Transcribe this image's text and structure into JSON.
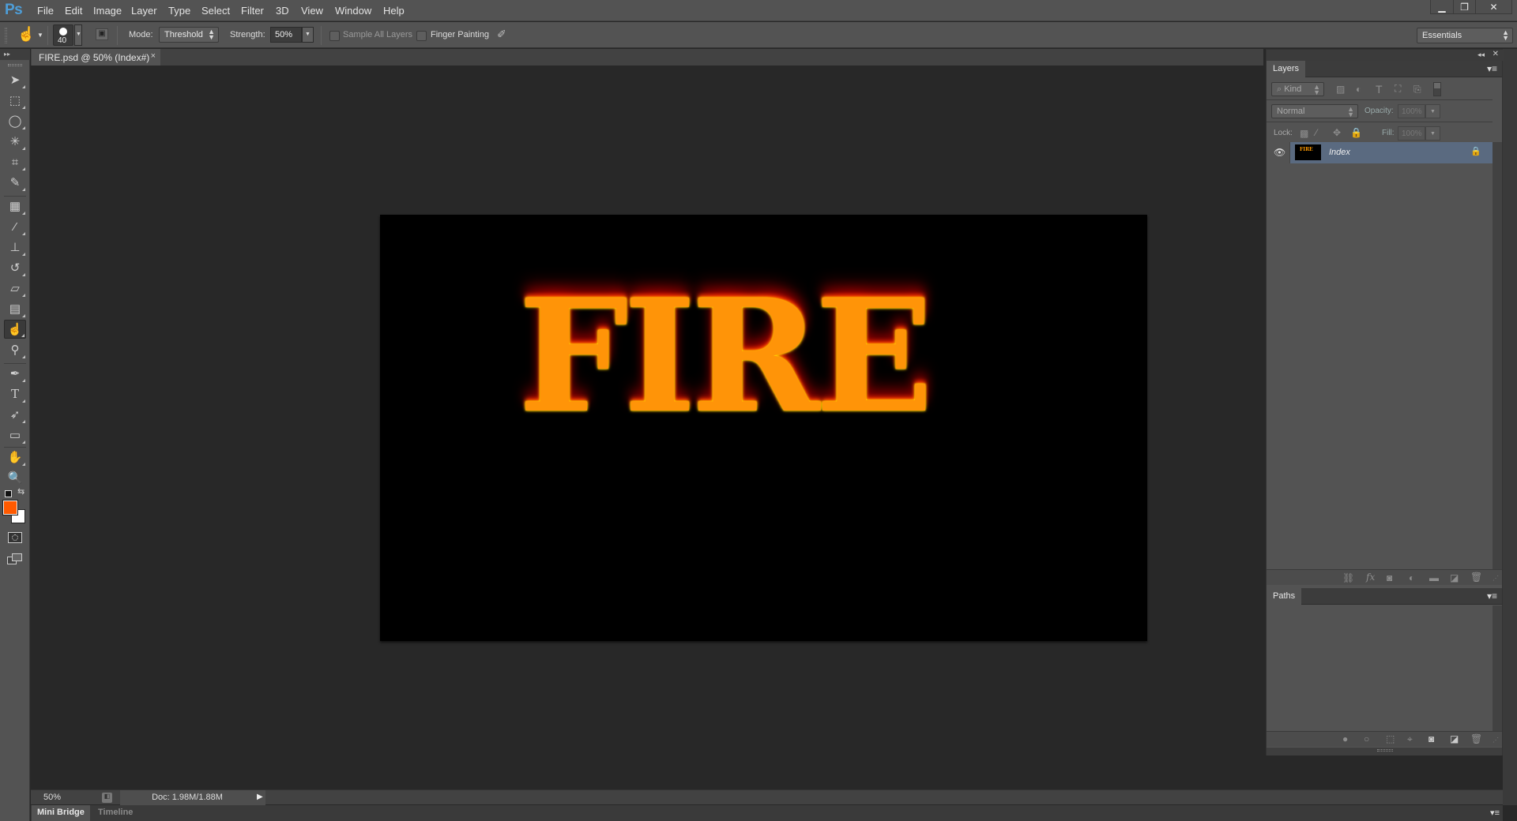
{
  "app": {
    "logo": "Ps"
  },
  "menu": [
    "File",
    "Edit",
    "Image",
    "Layer",
    "Type",
    "Select",
    "Filter",
    "3D",
    "View",
    "Window",
    "Help"
  ],
  "window_controls": {
    "minimize": "▁",
    "restore": "❐",
    "close": "✕"
  },
  "options": {
    "brush_size": "40",
    "mode_label": "Mode:",
    "mode_value": "Threshold",
    "strength_label": "Strength:",
    "strength_value": "50%",
    "sample_all_layers": {
      "label": "Sample All Layers",
      "checked": false
    },
    "finger_painting": {
      "label": "Finger Painting",
      "checked": false
    },
    "workspace": "Essentials"
  },
  "document": {
    "tab_title": "FIRE.psd @ 50% (Index#)",
    "close": "×",
    "canvas_text": "FIRE"
  },
  "tools": [
    {
      "name": "move",
      "glyph": "➤"
    },
    {
      "name": "rectangular-marquee",
      "glyph": "⬚"
    },
    {
      "name": "lasso",
      "glyph": "◯"
    },
    {
      "name": "magic-wand",
      "glyph": "✳"
    },
    {
      "name": "crop",
      "glyph": "⌗"
    },
    {
      "name": "eyedropper",
      "glyph": "✎"
    },
    {
      "name": "spot-healing",
      "glyph": "▦"
    },
    {
      "name": "brush",
      "glyph": "⁄"
    },
    {
      "name": "clone-stamp",
      "glyph": "⊥"
    },
    {
      "name": "history-brush",
      "glyph": "↺"
    },
    {
      "name": "eraser",
      "glyph": "▱"
    },
    {
      "name": "gradient",
      "glyph": "▤"
    },
    {
      "name": "smudge",
      "glyph": "☝",
      "active": true
    },
    {
      "name": "dodge",
      "glyph": "⚲"
    },
    {
      "name": "pen",
      "glyph": "✒"
    },
    {
      "name": "type",
      "glyph": "T"
    },
    {
      "name": "path-selection",
      "glyph": "➶"
    },
    {
      "name": "rectangle",
      "glyph": "▭"
    },
    {
      "name": "hand",
      "glyph": "✋"
    },
    {
      "name": "zoom",
      "glyph": "🔍"
    }
  ],
  "colors": {
    "foreground": "#ff5a00",
    "background": "#ffffff",
    "selected_layer": "#5a6a80"
  },
  "status": {
    "zoom": "50%",
    "doc": "Doc: 1.98M/1.88M"
  },
  "bottom_tabs": [
    "Mini Bridge",
    "Timeline"
  ],
  "layers_panel": {
    "title": "Layers",
    "filter_kind": "Kind",
    "blend_mode": "Normal",
    "opacity_label": "Opacity:",
    "opacity_value": "100%",
    "lock_label": "Lock:",
    "fill_label": "Fill:",
    "fill_value": "100%",
    "layers": [
      {
        "name": "Index",
        "visible": true,
        "locked": true,
        "selected": true
      }
    ]
  },
  "paths_panel": {
    "title": "Paths"
  }
}
